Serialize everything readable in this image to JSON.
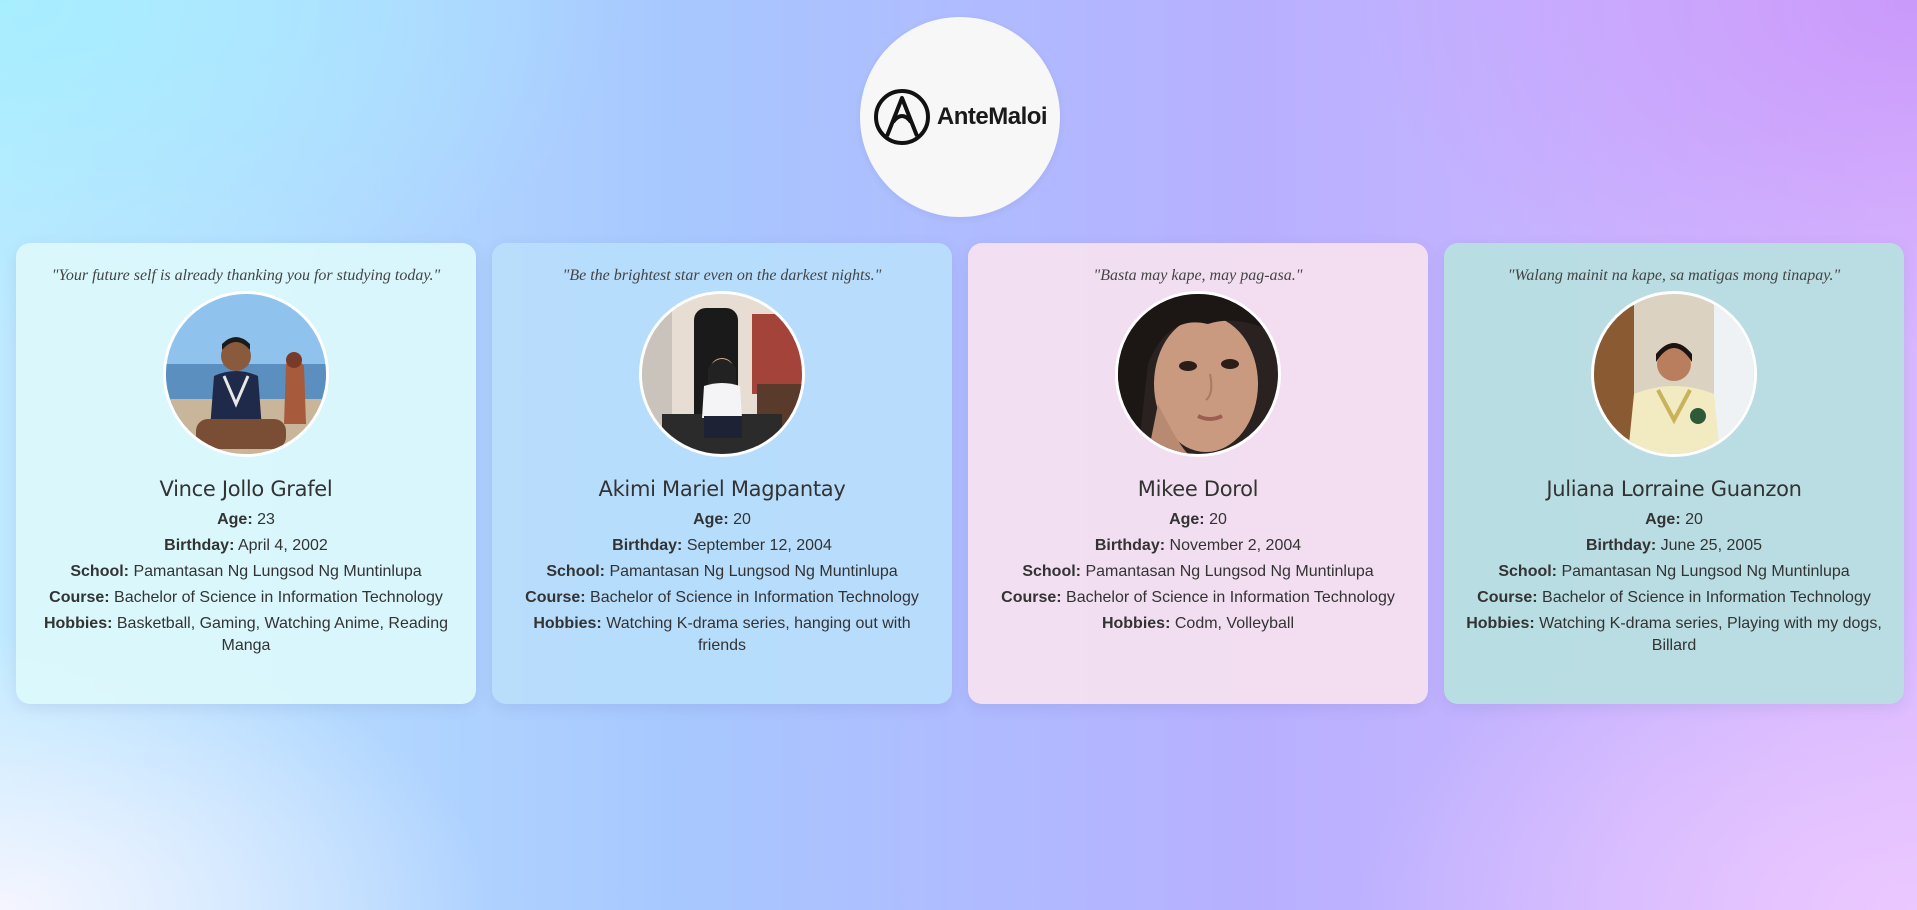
{
  "brand": {
    "logo_text": "AnteMaloi",
    "logo_icon": "antemaloi-logo-icon"
  },
  "labels": {
    "age": "Age:",
    "birthday": "Birthday:",
    "school": "School:",
    "course": "Course:",
    "hobbies": "Hobbies:"
  },
  "profiles": [
    {
      "quote": "\"Your future self is already thanking you for studying today.\"",
      "name": "Vince Jollo Grafel",
      "age": "23",
      "birthday": "April 4, 2002",
      "school": "Pamantasan Ng Lungsod Ng Muntinlupa",
      "course": "Bachelor of Science in Information Technology",
      "hobbies": "Basketball, Gaming, Watching Anime, Reading Manga",
      "card_color": "#dcf8fc"
    },
    {
      "quote": "\"Be the brightest star even on the darkest nights.\"",
      "name": "Akimi Mariel Magpantay",
      "age": "20",
      "birthday": "September 12, 2004",
      "school": "Pamantasan Ng Lungsod Ng Muntinlupa",
      "course": "Bachelor of Science in Information Technology",
      "hobbies": "Watching K-drama series, hanging out with friends",
      "card_color": "#b9defc"
    },
    {
      "quote": "\"Basta may kape, may pag-asa.\"",
      "name": "Mikee Dorol",
      "age": "20",
      "birthday": "November 2, 2004",
      "school": "Pamantasan Ng Lungsod Ng Muntinlupa",
      "course": "Bachelor of Science in Information Technology",
      "hobbies": "Codm, Volleyball",
      "card_color": "#f6e0f0"
    },
    {
      "quote": "\"Walang mainit na kape, sa matigas mong tinapay.\"",
      "name": "Juliana Lorraine Guanzon",
      "age": "20",
      "birthday": "June 25, 2005",
      "school": "Pamantasan Ng Lungsod Ng Muntinlupa",
      "course": "Bachelor of Science in Information Technology",
      "hobbies": "Watching K-drama series, Playing with my dogs, Billard",
      "card_color": "#b8dee2"
    }
  ]
}
